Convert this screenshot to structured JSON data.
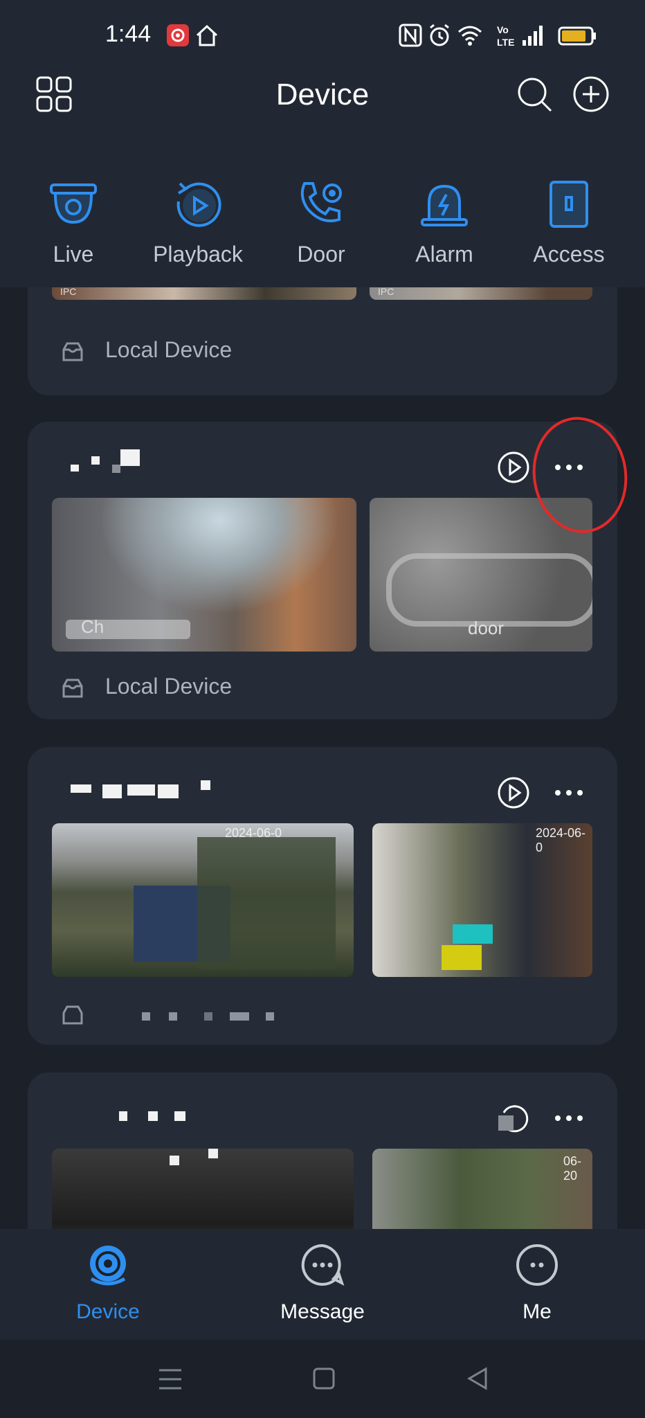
{
  "status": {
    "time": "1:44"
  },
  "header": {
    "title": "Device"
  },
  "quick_actions": [
    {
      "label": "Live",
      "icon": "live-camera-icon"
    },
    {
      "label": "Playback",
      "icon": "playback-icon"
    },
    {
      "label": "Door",
      "icon": "door-phone-icon"
    },
    {
      "label": "Alarm",
      "icon": "alarm-icon"
    },
    {
      "label": "Access",
      "icon": "access-icon"
    }
  ],
  "cards": [
    {
      "footer": "Local Device",
      "thumb_tags": [
        "IPC",
        "IPC"
      ]
    },
    {
      "footer": "Local Device",
      "thumb_labels": [
        "Ch",
        "door"
      ]
    },
    {
      "footer": "",
      "thumb_tags": [
        "2024-06-0",
        "2024-06-0"
      ]
    },
    {
      "footer": "",
      "thumb_tags": [
        "06-20"
      ]
    }
  ],
  "tabs": [
    {
      "label": "Device",
      "active": true
    },
    {
      "label": "Message",
      "active": false
    },
    {
      "label": "Me",
      "active": false
    }
  ],
  "colors": {
    "accent": "#2f8ff0",
    "background": "#1b2029",
    "card": "#262c37",
    "annotation": "#e12a2a"
  }
}
